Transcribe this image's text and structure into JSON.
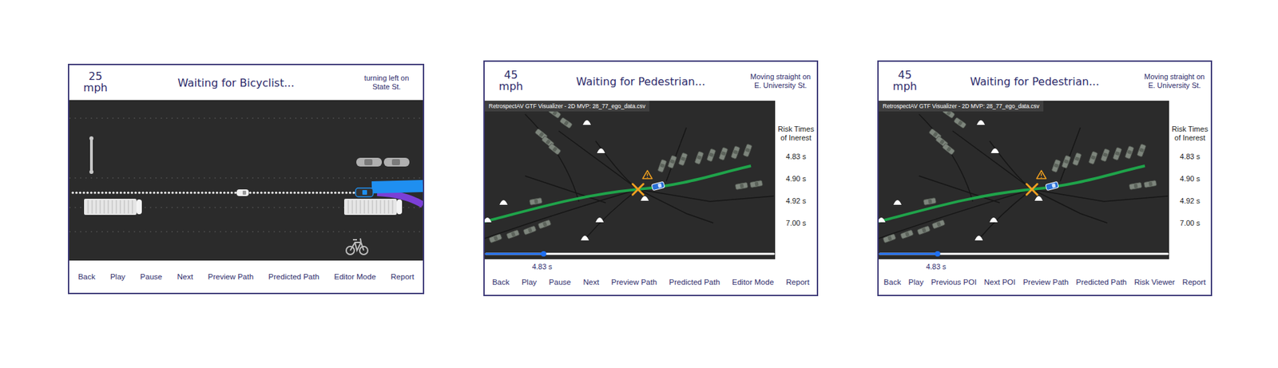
{
  "cards": [
    {
      "kind": "street",
      "speed": "25",
      "unit": "mph",
      "title": "Waiting for Bicyclist...",
      "maneuver": "turning left on State St.",
      "buttons": [
        "Back",
        "Play",
        "Pause",
        "Next",
        "Preview Path",
        "Predicted Path",
        "Editor Mode",
        "Report"
      ]
    },
    {
      "kind": "map",
      "speed": "45",
      "unit": "mph",
      "title": "Waiting for Pedestrian...",
      "maneuver": "Moving straight on E. University St.",
      "canvas_label": "RetrospectAV GTF Visualizer - 2D MVP: 28_77_ego_data.csv",
      "risk": {
        "title": "Risk Times of Inerest",
        "times": [
          "4.83 s",
          "4.90 s",
          "4.92 s",
          "7.00 s"
        ]
      },
      "timeline": {
        "level": 0.2,
        "reading": "4.83 s"
      },
      "buttons": [
        "Back",
        "Play",
        "Pause",
        "Next",
        "Preview Path",
        "Predicted Path",
        "Editor Mode",
        "Report"
      ]
    },
    {
      "kind": "map",
      "speed": "45",
      "unit": "mph",
      "title": "Waiting for Pedestrian...",
      "maneuver": "Moving straight on E. University St.",
      "canvas_label": "RetrospectAV GTF Visualizer - 2D MVP: 28_77_ego_data.csv",
      "risk": {
        "title": "Risk Times of Inerest",
        "times": [
          "4.83 s",
          "4.90 s",
          "4.92 s",
          "7.00 s"
        ]
      },
      "timeline": {
        "level": 0.2,
        "reading": "4.83 s"
      },
      "buttons": [
        "Back",
        "Play",
        "Previous POI",
        "Next POI",
        "Preview Path",
        "Predicted Path",
        "Risk Viewer",
        "Report"
      ]
    }
  ]
}
